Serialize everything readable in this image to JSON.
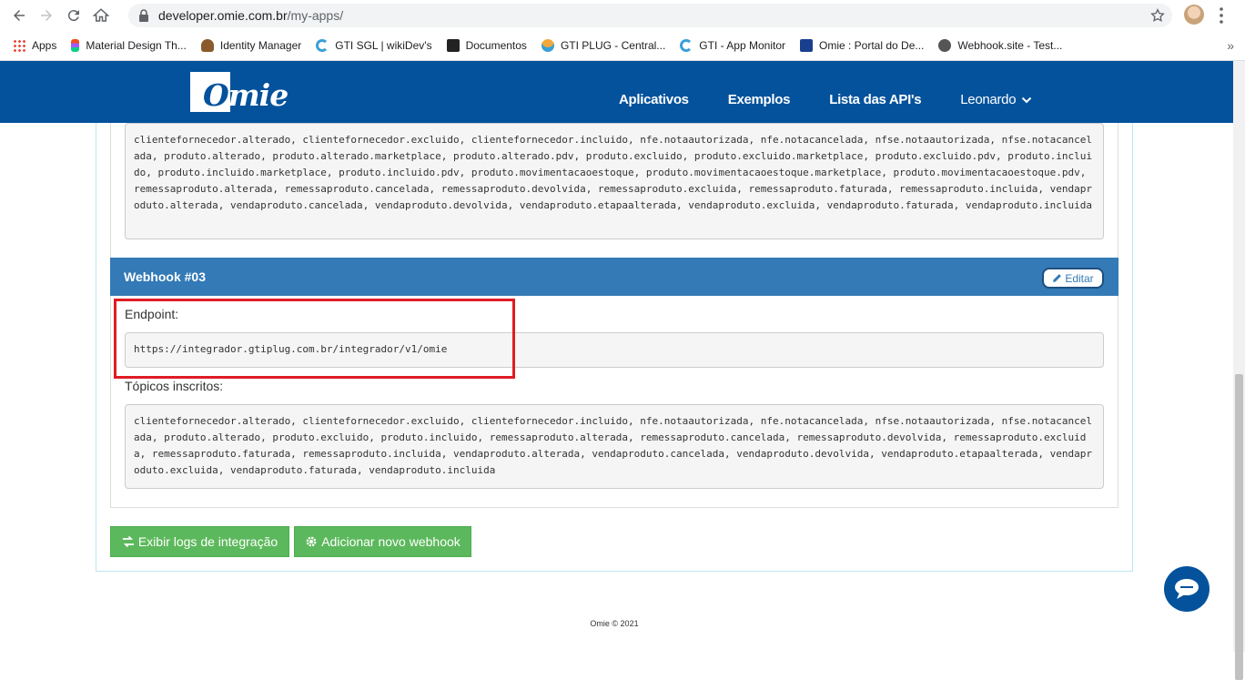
{
  "browser": {
    "url_host": "developer.omie.com.br",
    "url_path": "/my-apps/",
    "bookmarks": [
      {
        "label": "Apps",
        "icon": "apps-grid-icon"
      },
      {
        "label": "Material Design Th...",
        "icon": "figma-icon"
      },
      {
        "label": "Identity Manager",
        "icon": "identity-icon"
      },
      {
        "label": "GTI SGL | wikiDev's",
        "icon": "gti-icon"
      },
      {
        "label": "Documentos",
        "icon": "docs-icon"
      },
      {
        "label": "GTI PLUG - Central...",
        "icon": "gti-plug-icon"
      },
      {
        "label": "GTI - App Monitor",
        "icon": "gti-icon"
      },
      {
        "label": "Omie : Portal do De...",
        "icon": "omie-icon"
      },
      {
        "label": "Webhook.site - Test...",
        "icon": "webhook-icon"
      }
    ]
  },
  "header": {
    "logo_first": "O",
    "logo_rest": "mie",
    "nav": [
      "Aplicativos",
      "Exemplos",
      "Lista das API's"
    ],
    "user": "Leonardo"
  },
  "topics_prev": "clientefornecedor.alterado, clientefornecedor.excluido, clientefornecedor.incluido, nfe.notaautorizada, nfe.notacancelada, nfse.notaautorizada, nfse.notacancelada, produto.alterado, produto.alterado.marketplace, produto.alterado.pdv, produto.excluido, produto.excluido.marketplace, produto.excluido.pdv, produto.incluido, produto.incluido.marketplace, produto.incluido.pdv, produto.movimentacaoestoque, produto.movimentacaoestoque.marketplace, produto.movimentacaoestoque.pdv, remessaproduto.alterada, remessaproduto.cancelada, remessaproduto.devolvida, remessaproduto.excluida, remessaproduto.faturada, remessaproduto.incluida, vendaproduto.alterada, vendaproduto.cancelada, vendaproduto.devolvida, vendaproduto.etapaalterada, vendaproduto.excluida, vendaproduto.faturada, vendaproduto.incluida",
  "webhook": {
    "title": "Webhook #03",
    "edit_label": "Editar",
    "endpoint_label": "Endpoint:",
    "endpoint": "https://integrador.gtiplug.com.br/integrador/v1/omie",
    "topics_label": "Tópicos inscritos:",
    "topics": "clientefornecedor.alterado, clientefornecedor.excluido, clientefornecedor.incluido, nfe.notaautorizada, nfe.notacancelada, nfse.notaautorizada, nfse.notacancelada, produto.alterado, produto.excluido, produto.incluido, remessaproduto.alterada, remessaproduto.cancelada, remessaproduto.devolvida, remessaproduto.excluida, remessaproduto.faturada, remessaproduto.incluida, vendaproduto.alterada, vendaproduto.cancelada, vendaproduto.devolvida, vendaproduto.etapaalterada, vendaproduto.excluida, vendaproduto.faturada, vendaproduto.incluida"
  },
  "actions": {
    "logs_label": "Exibir logs de integração",
    "add_label": "Adicionar novo webhook"
  },
  "footer": "Omie © 2021",
  "colors": {
    "brand_blue": "#04529c",
    "panel_blue": "#337ab7",
    "success_green": "#5cb85c",
    "highlight_red": "#e01b24"
  }
}
